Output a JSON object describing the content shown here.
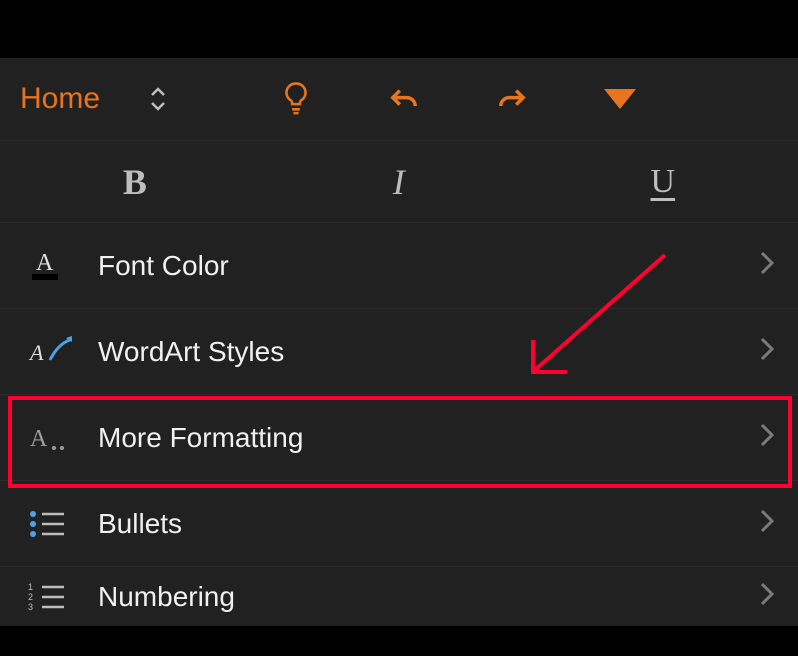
{
  "toolbar": {
    "tab_label": "Home"
  },
  "format": {
    "bold": "B",
    "italic": "I",
    "underline": "U"
  },
  "menu": {
    "font_color": "Font Color",
    "wordart": "WordArt Styles",
    "more_formatting": "More Formatting",
    "bullets": "Bullets",
    "numbering": "Numbering"
  }
}
